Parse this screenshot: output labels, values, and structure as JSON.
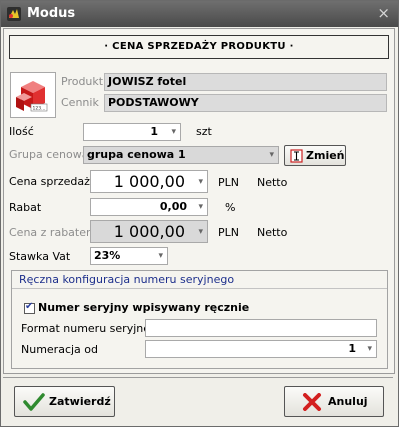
{
  "window": {
    "title": "Modus",
    "close": "×"
  },
  "header": {
    "title": "· CENA SPRZEDAŻY PRODUKTU ·"
  },
  "product": {
    "label_product": "Produkt",
    "product_value": "JOWISZ fotel",
    "label_price_list": "Cennik",
    "price_list_value": "PODSTAWOWY",
    "image_caption": "123..."
  },
  "qty": {
    "label": "Ilość",
    "value": "1",
    "unit": "szt"
  },
  "price_group": {
    "label": "Grupa cenowa",
    "value": "grupa cenowa 1",
    "change_label": "Zmień"
  },
  "sale_price": {
    "label": "Cena sprzedaży",
    "value": "1 000,00",
    "currency": "PLN",
    "mode": "Netto"
  },
  "discount": {
    "label": "Rabat",
    "value": "0,00",
    "unit": "%"
  },
  "discounted_price": {
    "label": "Cena z rabatem",
    "value": "1 000,00",
    "currency": "PLN",
    "mode": "Netto"
  },
  "vat": {
    "label": "Stawka Vat",
    "value": "23%"
  },
  "serial": {
    "group_title": "Ręczna konfiguracja numeru seryjnego",
    "manual_label": "Numer seryjny wpisywany ręcznie",
    "manual_checked": true,
    "format_label": "Format numeru seryjnego",
    "format_value": "",
    "numbering_label": "Numeracja od",
    "numbering_value": "1"
  },
  "buttons": {
    "confirm": "Zatwierdź",
    "cancel": "Anuluj"
  },
  "icons": {
    "dropdown": "▾",
    "check": "✔"
  }
}
